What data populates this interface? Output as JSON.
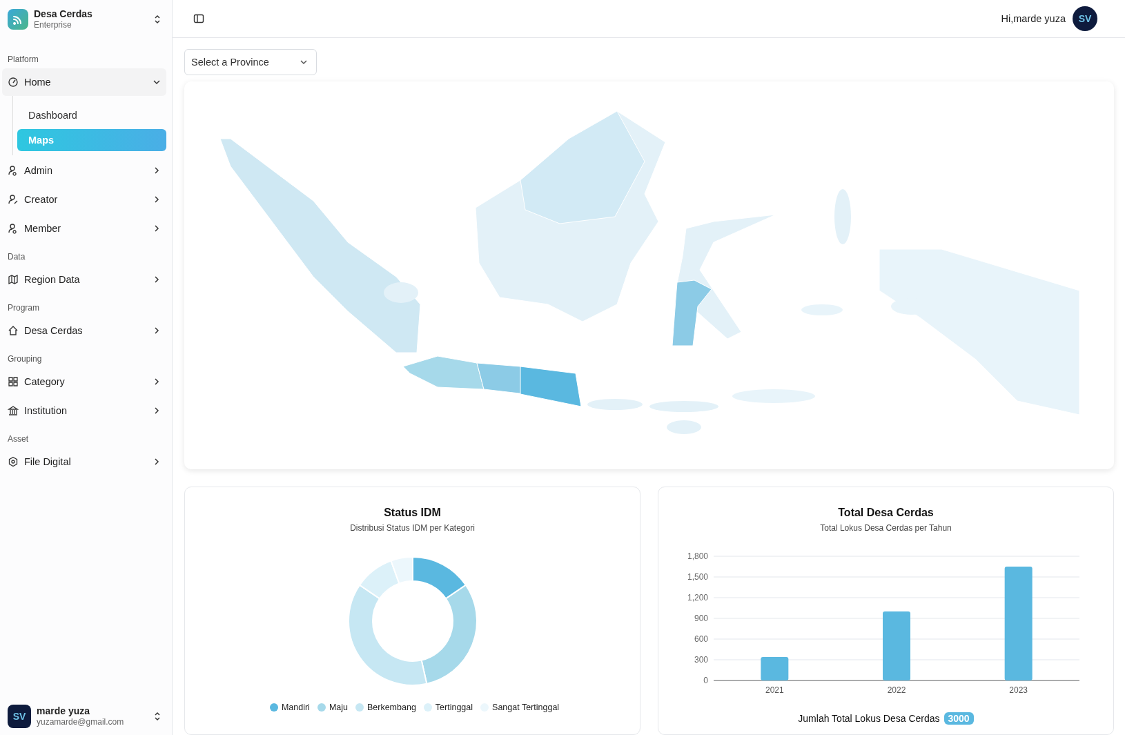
{
  "brand": {
    "name": "Desa Cerdas",
    "plan": "Enterprise"
  },
  "sidebar": {
    "groups": [
      {
        "label": "Platform",
        "items": [
          {
            "label": "Home",
            "kind": "gauge",
            "expanded": true,
            "children": [
              {
                "label": "Dashboard",
                "selected": false
              },
              {
                "label": "Maps",
                "selected": true
              }
            ]
          },
          {
            "label": "Admin",
            "kind": "user",
            "expanded": false
          },
          {
            "label": "Creator",
            "kind": "userpen",
            "expanded": false
          },
          {
            "label": "Member",
            "kind": "user",
            "expanded": false
          }
        ]
      },
      {
        "label": "Data",
        "items": [
          {
            "label": "Region Data",
            "kind": "map",
            "expanded": false
          }
        ]
      },
      {
        "label": "Program",
        "items": [
          {
            "label": "Desa Cerdas",
            "kind": "house",
            "expanded": false
          }
        ]
      },
      {
        "label": "Grouping",
        "items": [
          {
            "label": "Category",
            "kind": "grid",
            "expanded": false
          },
          {
            "label": "Institution",
            "kind": "building",
            "expanded": false
          }
        ]
      },
      {
        "label": "Asset",
        "items": [
          {
            "label": "File Digital",
            "kind": "hex",
            "expanded": false
          }
        ]
      }
    ]
  },
  "user": {
    "name": "marde yuza",
    "email": "yuzamarde@gmail.com",
    "initials": "SV"
  },
  "header": {
    "greeting": "Hi,marde yuza",
    "initials": "SV"
  },
  "province_select": {
    "placeholder": "Select a Province"
  },
  "status_card": {
    "title": "Status IDM",
    "subtitle": "Distribusi Status IDM per Kategori",
    "legend": [
      {
        "label": "Mandiri",
        "color": "#5ab8e0"
      },
      {
        "label": "Maju",
        "color": "#a6d9ea"
      },
      {
        "label": "Berkembang",
        "color": "#c6e7f3"
      },
      {
        "label": "Tertinggal",
        "color": "#dcf1f9"
      },
      {
        "label": "Sangat Tertinggal",
        "color": "#ecf7fc"
      }
    ]
  },
  "total_card": {
    "title": "Total Desa Cerdas",
    "subtitle": "Total Lokus Desa Cerdas per Tahun",
    "chart_data": {
      "type": "bar",
      "categories": [
        "2021",
        "2022",
        "2023"
      ],
      "values": [
        340,
        1000,
        1650
      ],
      "grid": true,
      "ylim": [
        0,
        1800
      ],
      "yticks": [
        0,
        300,
        600,
        900,
        {
          "value": 1200,
          "label": "1,200"
        },
        {
          "value": 1500,
          "label": "1,500"
        },
        {
          "value": 1800,
          "label": "1,800"
        }
      ]
    },
    "footer_label": "Jumlah Total Lokus Desa Cerdas",
    "footer_value": "3000"
  }
}
